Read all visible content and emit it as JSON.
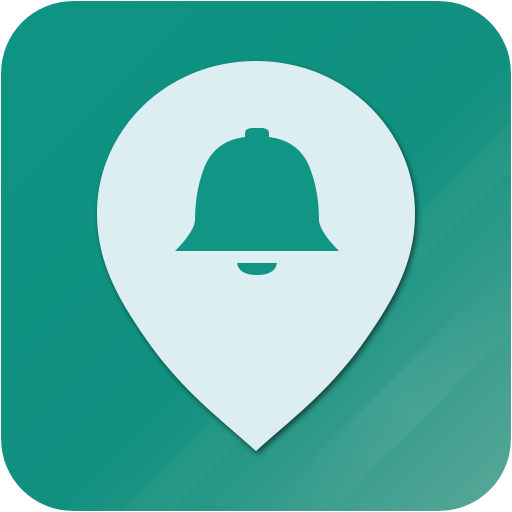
{
  "icon": {
    "name": "location-bell-app-icon",
    "glyphs": [
      "map-pin-icon",
      "bell-icon"
    ],
    "colors": {
      "background_top": "#0e9484",
      "background_bottom": "#5aa898",
      "pin_fill": "#ddeef3",
      "bell_fill": "#119584",
      "highlight": "#ffffff"
    }
  }
}
